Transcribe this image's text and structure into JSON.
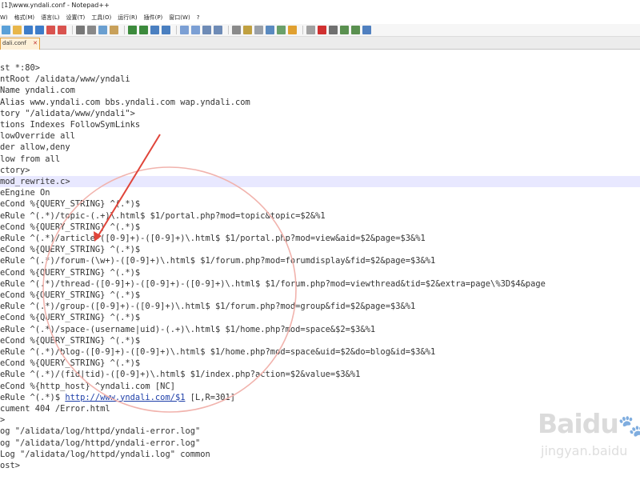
{
  "window": {
    "title": "[1]\\www.yndali.conf - Notepad++"
  },
  "menu": [
    "W)",
    "格式(M)",
    "语言(L)",
    "设置(T)",
    "工具(O)",
    "运行(R)",
    "插件(P)",
    "窗口(W)",
    "?"
  ],
  "tab": {
    "label": "dali.conf",
    "close": "✕"
  },
  "editor": {
    "highlighted_line": 10,
    "lines": [
      "st *:80>",
      "ntRoot /alidata/www/yndali",
      "Name yndali.com",
      "Alias www.yndali.com bbs.yndali.com wap.yndali.com",
      "tory \"/alidata/www/yndali\">",
      "tions Indexes FollowSymLinks",
      "lowOverride all",
      "der allow,deny",
      "low from all",
      "ctory>",
      "mod_rewrite.c>",
      "eEngine On",
      "eCond %{QUERY_STRING} ^(.*)$",
      "eRule ^(.*)/topic-(.+)\\.html$ $1/portal.php?mod=topic&topic=$2&%1",
      "eCond %{QUERY_STRING} ^(.*)$",
      "eRule ^(.*)/article-([0-9]+)-([0-9]+)\\.html$ $1/portal.php?mod=view&aid=$2&page=$3&%1",
      "eCond %{QUERY_STRING} ^(.*)$",
      "eRule ^(.*)/forum-(\\w+)-([0-9]+)\\.html$ $1/forum.php?mod=forumdisplay&fid=$2&page=$3&%1",
      "eCond %{QUERY_STRING} ^(.*)$",
      "eRule ^(.*)/thread-([0-9]+)-([0-9]+)-([0-9]+)\\.html$ $1/forum.php?mod=viewthread&tid=$2&extra=page\\%3D$4&page",
      "eCond %{QUERY_STRING} ^(.*)$",
      "eRule ^(.*)/group-([0-9]+)-([0-9]+)\\.html$ $1/forum.php?mod=group&fid=$2&page=$3&%1",
      "eCond %{QUERY_STRING} ^(.*)$",
      "eRule ^(.*)/space-(username|uid)-(.+)\\.html$ $1/home.php?mod=space&$2=$3&%1",
      "eCond %{QUERY_STRING} ^(.*)$",
      "eRule ^(.*)/blog-([0-9]+)-([0-9]+)\\.html$ $1/home.php?mod=space&uid=$2&do=blog&id=$3&%1",
      "eCond %{QUERY_STRING} ^(.*)$",
      "eRule ^(.*)/(fid|tid)-([0-9]+)\\.html$ $1/index.php?action=$2&value=$3&%1",
      "eCond %{http_host} ^yndali.com [NC]",
      "eRule ^(.*)$ http://www.yndali.com/$1 [L,R=301]",
      "cument 404 /Error.html",
      ">",
      "og \"/alidata/log/httpd/yndali-error.log\"",
      "og \"/alidata/log/httpd/yndali-error.log\"",
      "Log \"/alidata/log/httpd/yndali.log\" common",
      "ost>"
    ],
    "link_line": {
      "before": "eRule ^(.*)$ ",
      "link": "http://www.yndali.com/$1",
      "after": " [L,R=301]"
    }
  },
  "annotation": {
    "color": "#e0453a",
    "ellipse_color": "#f1b3ad"
  },
  "watermark": {
    "brand": "Baidu",
    "paw": "🐾",
    "sub": "jingyan.baidu"
  },
  "toolbar_icons": [
    "new-icon",
    "open-icon",
    "save-icon",
    "save-all-icon",
    "close-icon",
    "close-all-icon",
    "print-icon",
    "cut-icon",
    "copy-icon",
    "paste-icon",
    "undo-icon",
    "redo-icon",
    "find-icon",
    "replace-icon",
    "zoom-in-icon",
    "zoom-out-icon",
    "sync-v-icon",
    "sync-h-icon",
    "wrap-icon",
    "all-chars-icon",
    "indent-guide-icon",
    "doc-map-icon",
    "function-list-icon",
    "folder-icon",
    "monitor-icon",
    "record-icon",
    "stop-icon",
    "play-icon",
    "play-multi-icon",
    "save-macro-icon"
  ]
}
